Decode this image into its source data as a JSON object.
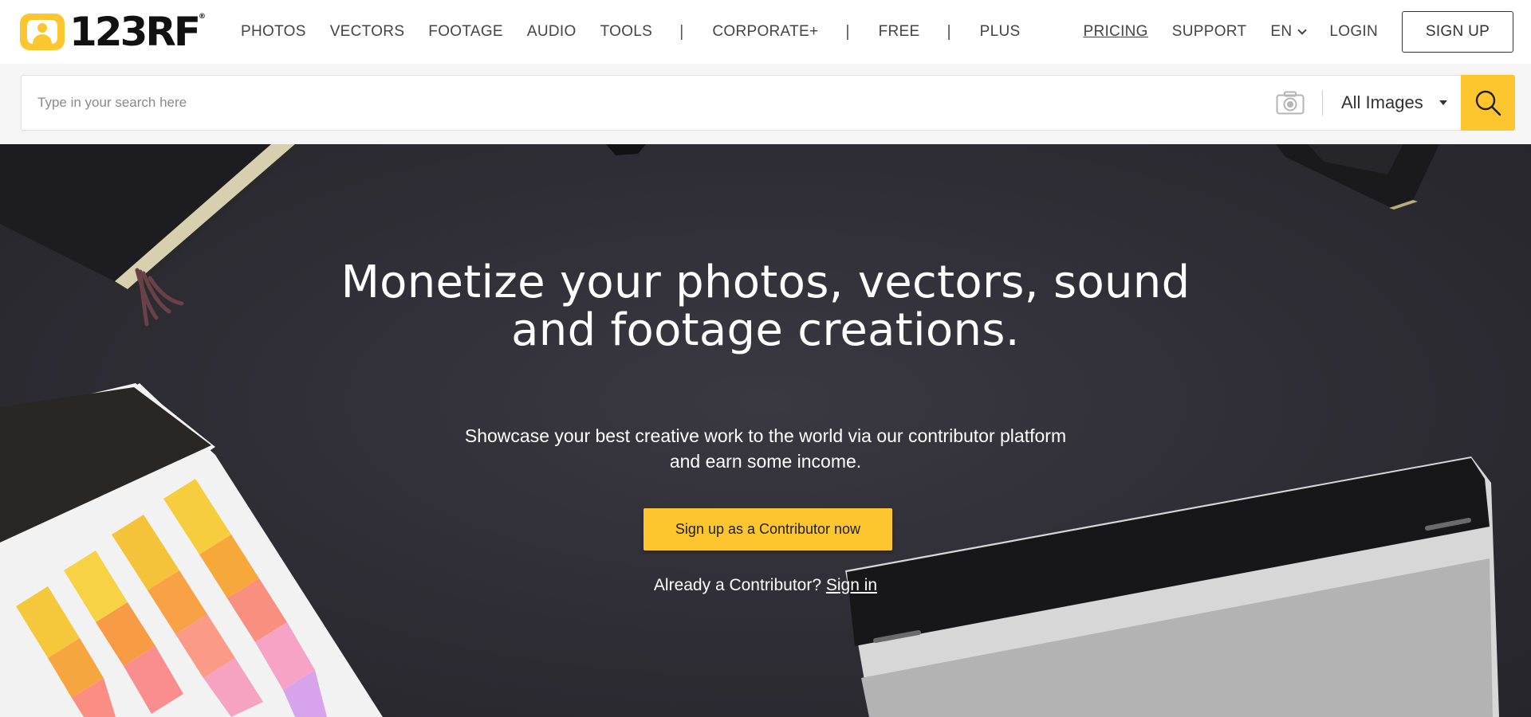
{
  "brand": {
    "logo_text": "123RF",
    "trademark": "®",
    "accent_color": "#fdc62e"
  },
  "nav": {
    "left_items": [
      "PHOTOS",
      "VECTORS",
      "FOOTAGE",
      "AUDIO",
      "TOOLS"
    ],
    "separator": "|",
    "corporate": "CORPORATE+",
    "free": "FREE",
    "plus": "PLUS",
    "pricing": "PRICING",
    "support": "SUPPORT",
    "language": "EN",
    "login": "LOGIN",
    "signup": "SIGN UP"
  },
  "search": {
    "placeholder": "Type in your search here",
    "value": "",
    "type_selected": "All Images",
    "camera_icon": "camera-icon",
    "search_icon": "magnifier-icon"
  },
  "hero": {
    "title_line1": "Monetize your photos, vectors, sound",
    "title_line2": "and footage creations.",
    "subtitle_line1": "Showcase your best creative work to the world via our contributor platform",
    "subtitle_line2": "and earn some income.",
    "cta_label": "Sign up as a Contributor now",
    "signin_prompt": "Already a Contributor?",
    "signin_link": "Sign in"
  }
}
